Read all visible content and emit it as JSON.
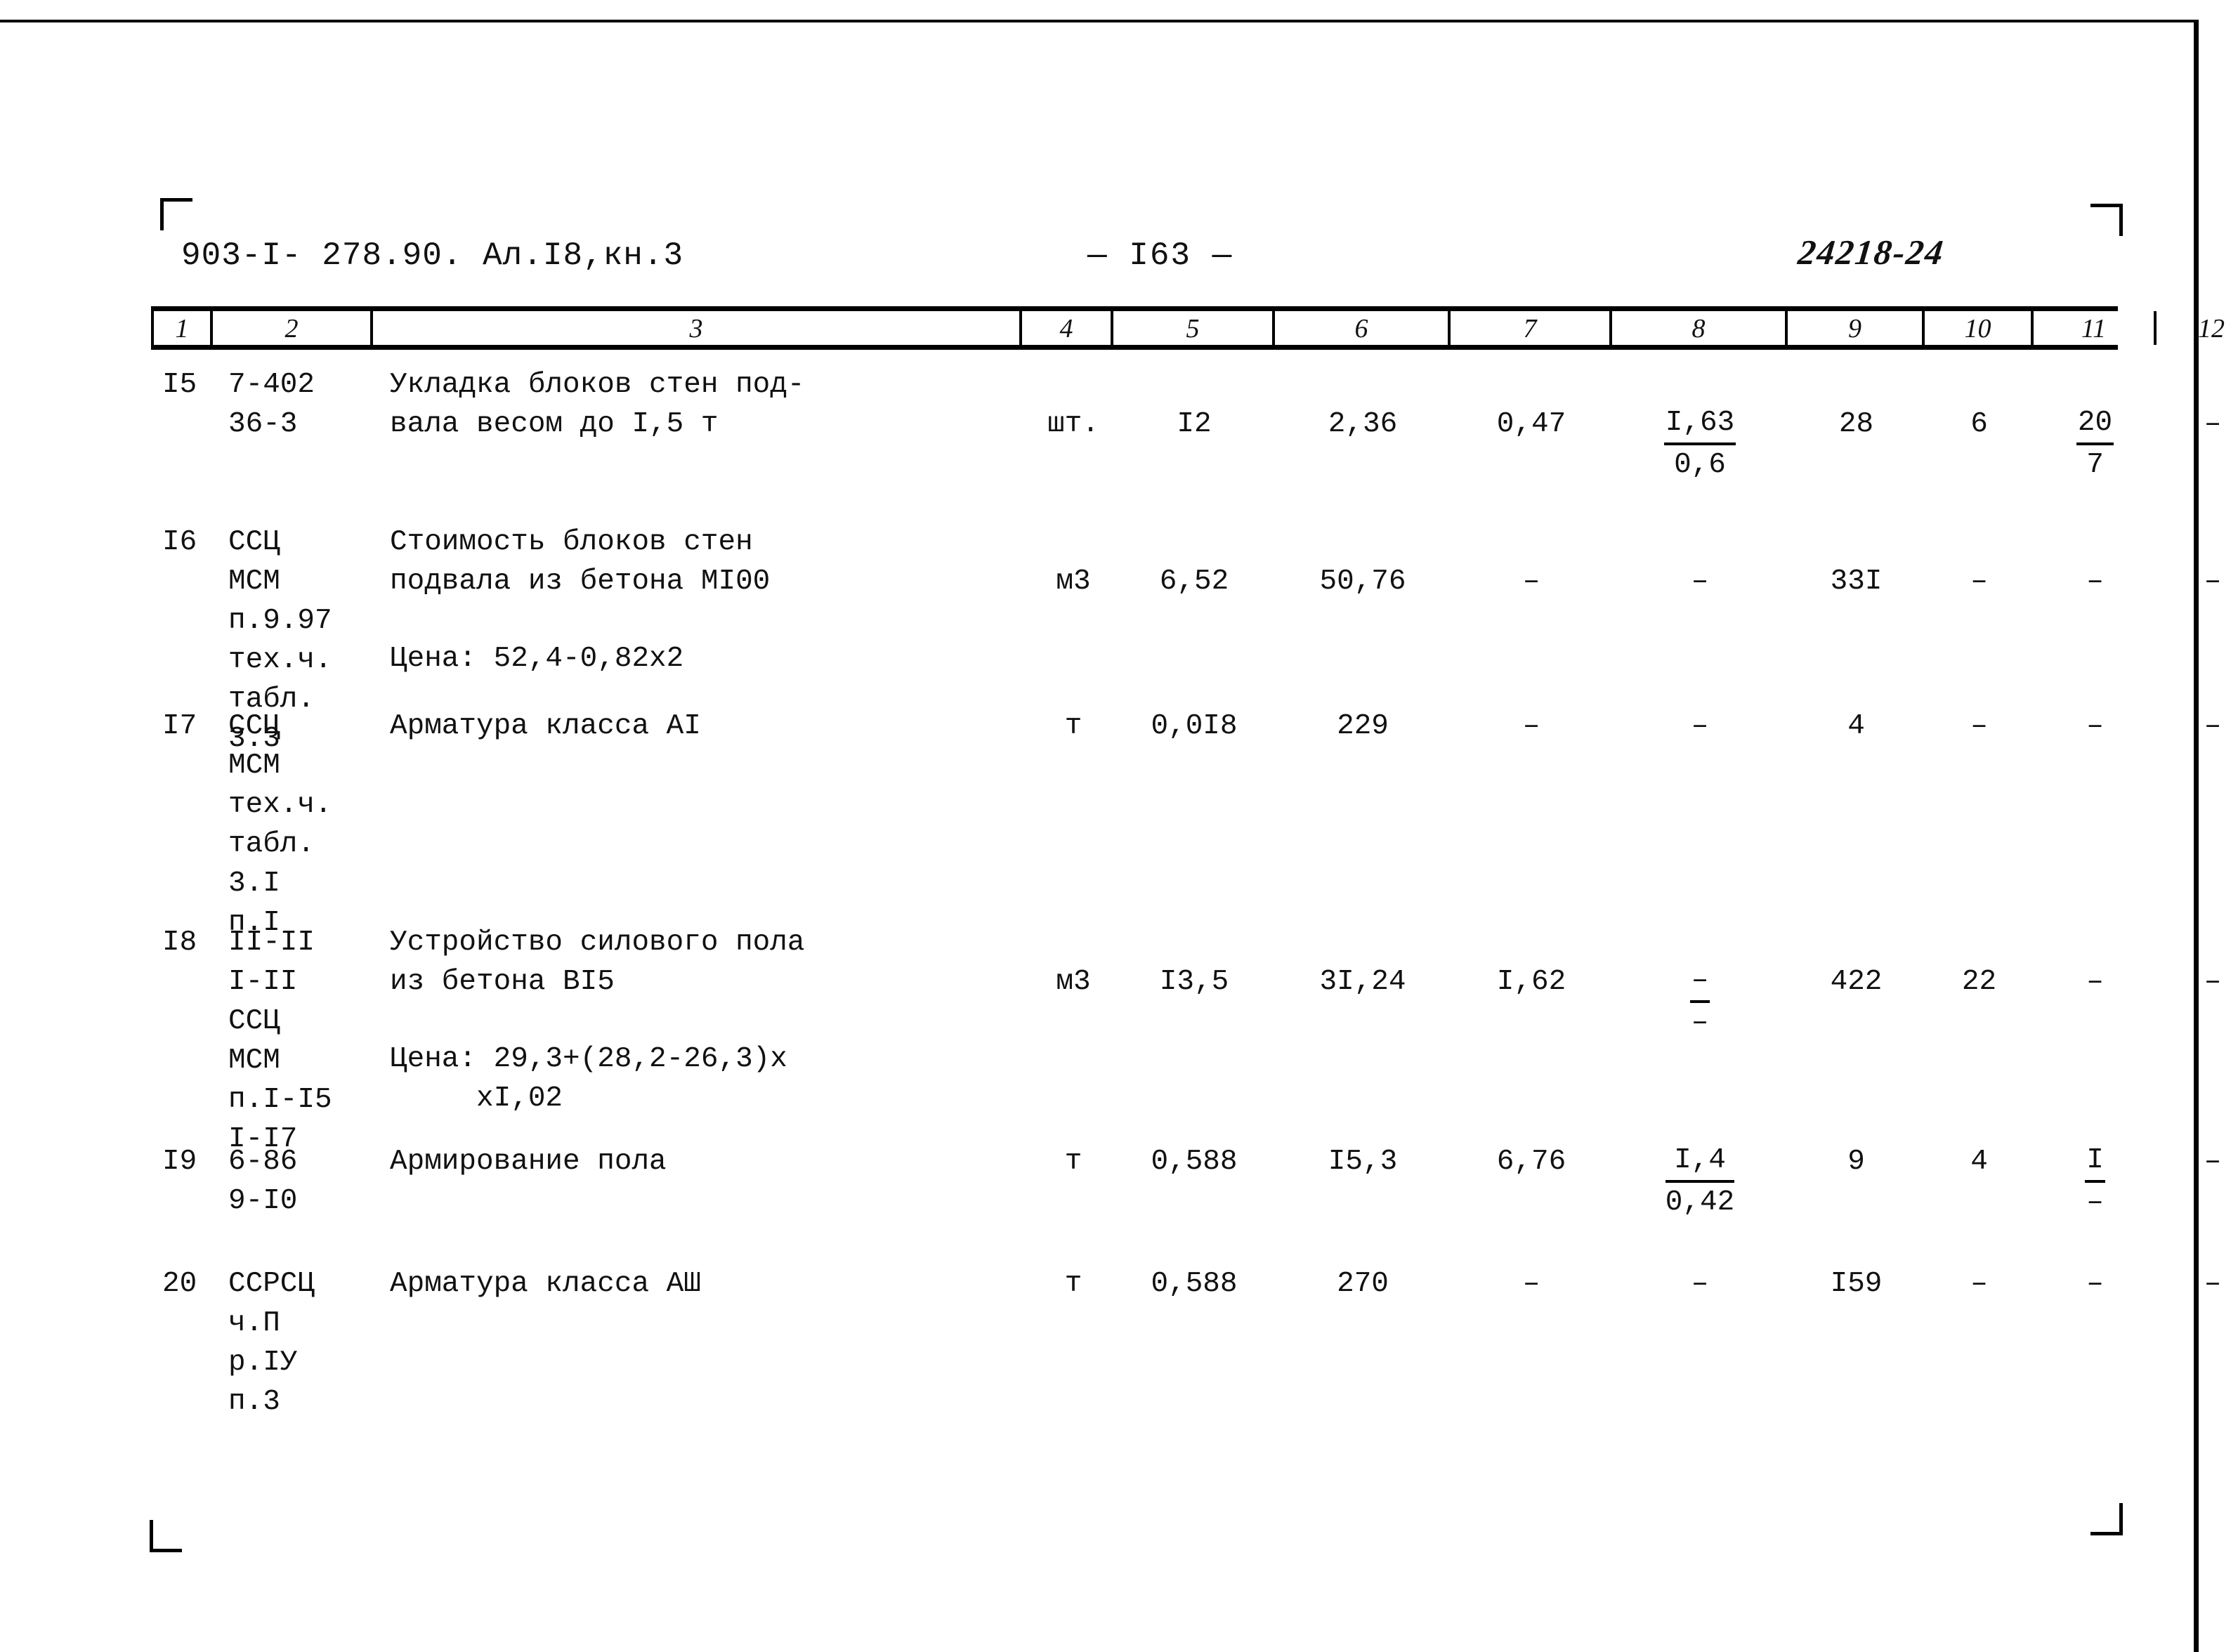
{
  "header": {
    "doc_code": "903-I- 278.90.  Ал.I8,кн.3",
    "page_number": "— I63 —",
    "archive_number": "24218-24"
  },
  "table": {
    "column_numbers": [
      "1",
      "2",
      "3",
      "4",
      "5",
      "6",
      "7",
      "8",
      "9",
      "10",
      "11",
      "12"
    ],
    "rows": [
      {
        "num": "I5",
        "code": "7-402\n36-3",
        "description": "Укладка блоков стен под-\nвала весом до I,5 т",
        "unit": "шт.",
        "c5": "I2",
        "c6": "2,36",
        "c7": "0,47",
        "c8_num": "I,63",
        "c8_den": "0,6",
        "c9": "28",
        "c10": "6",
        "c11_num": "20",
        "c11_den": "7",
        "c12": "–"
      },
      {
        "num": "I6",
        "code": "ССЦ\nМСМ\nп.9.97\nтех.ч.\nтабл.\n3.3",
        "description": "Стоимость блоков стен\nподвала из бетона МI00",
        "note": "Цена: 52,4-0,82х2",
        "unit": "м3",
        "c5": "6,52",
        "c6": "50,76",
        "c7": "–",
        "c8": "–",
        "c9": "33I",
        "c10": "–",
        "c11": "–",
        "c12": "–"
      },
      {
        "num": "I7",
        "code": "ССЦ\nМСМ\nтех.ч.\nтабл.\n3.I\nп.I",
        "description": "Арматура класса АI",
        "unit": "т",
        "c5": "0,0I8",
        "c6": "229",
        "c7": "–",
        "c8": "–",
        "c9": "4",
        "c10": "–",
        "c11": "–",
        "c12": "–"
      },
      {
        "num": "I8",
        "code": "II-II\nI-II\nССЦ\nМСМ\nп.I-I5\nI-I7",
        "description": "Устройство силового пола\nиз бетона ВI5",
        "note": "Цена: 29,3+(28,2-26,3)х\n     хI,02",
        "unit": "м3",
        "c5": "I3,5",
        "c6": "3I,24",
        "c7": "I,62",
        "c8_num": "–",
        "c8_den": "–",
        "c9": "422",
        "c10": "22",
        "c11": "–",
        "c12": "–"
      },
      {
        "num": "I9",
        "code": "6-86\n9-I0",
        "description": "Армирование пола",
        "unit": "т",
        "c5": "0,588",
        "c6": "I5,3",
        "c7": "6,76",
        "c8_num": "I,4",
        "c8_den": "0,42",
        "c9": "9",
        "c10": "4",
        "c11_num": "I",
        "c11_den": "–",
        "c12": "–"
      },
      {
        "num": "20",
        "code": "ССРСЦ\nч.П\nр.IУ\nп.3",
        "description": "Арматура класса АШ",
        "unit": "т",
        "c5": "0,588",
        "c6": "270",
        "c7": "–",
        "c8": "–",
        "c9": "I59",
        "c10": "–",
        "c11": "–",
        "c12": "–"
      }
    ]
  }
}
